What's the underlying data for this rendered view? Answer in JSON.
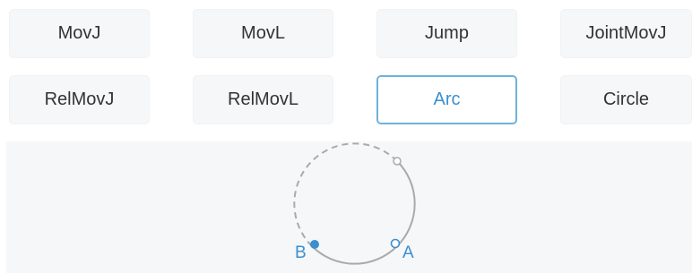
{
  "motion_buttons": {
    "row1": [
      "MovJ",
      "MovL",
      "Jump",
      "JointMovJ"
    ],
    "row2": [
      "RelMovJ",
      "RelMovL",
      "Arc",
      "Circle"
    ]
  },
  "selected_mode": "Arc",
  "arc_preview": {
    "point_labels": {
      "start": "B",
      "end": "A"
    }
  },
  "colors": {
    "accent": "#3a8fd1",
    "selected_border": "#6fb2dc",
    "arc_line": "#aaaaaa",
    "button_bg": "#f6f7f8",
    "text": "#333333"
  }
}
